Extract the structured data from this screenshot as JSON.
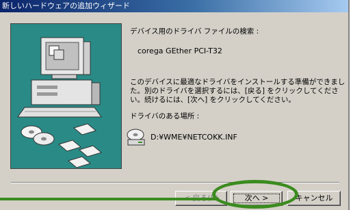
{
  "window": {
    "title": "新しいハードウェアの追加ウィザード"
  },
  "content": {
    "heading": "デバイス用のドライバ ファイルの検索 :",
    "device_name": "corega GEther PCI-T32",
    "description": "このデバイスに最適なドライバをインストールする準備ができました。別のドライバを選択するには、[戻る] をクリックしてください。続けるには、[次へ] をクリックしてください。",
    "location_label": "ドライバのある場所 :",
    "driver_path": "D:¥WME¥NETCOKK.INF"
  },
  "buttons": {
    "back": "< 戻る(B)",
    "next": "次へ >",
    "cancel": "キャンセル"
  },
  "colors": {
    "highlight": "#3b8b1f",
    "art_background": "#2a8a86",
    "title_gradient_start": "#0a246a"
  },
  "icons": [
    "computer-illustration",
    "cd-disc-icon",
    "floppy-disk-icon",
    "cd-drive-icon"
  ]
}
